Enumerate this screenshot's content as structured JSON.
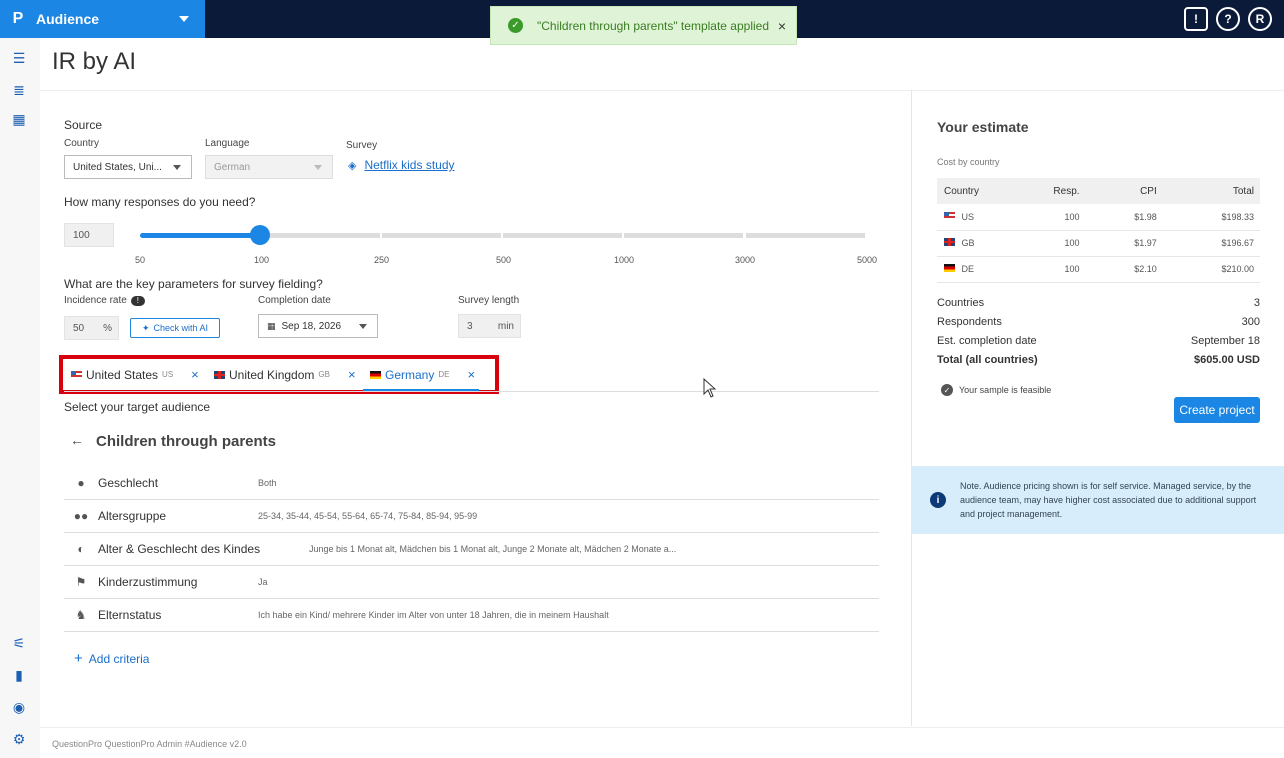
{
  "topbar": {
    "logo": "P",
    "app_name": "Audience",
    "icons": [
      "feedback-icon",
      "help-icon",
      "user-avatar"
    ],
    "help_label": "?",
    "avatar_label": "R",
    "feedback_label": "!"
  },
  "toast": {
    "message": "\"Children through parents\" template applied",
    "close": "×"
  },
  "page": {
    "title": "IR by AI"
  },
  "source": {
    "heading": "Source",
    "country_label": "Country",
    "country_value": "United States, Uni...",
    "language_label": "Language",
    "language_value": "German",
    "survey_label": "Survey",
    "survey_link": "Netflix kids study"
  },
  "responses": {
    "question": "How many responses do you need?",
    "value": "100",
    "ticks": [
      "50",
      "100",
      "250",
      "500",
      "1000",
      "3000",
      "5000"
    ]
  },
  "params": {
    "question": "What are the key parameters for survey fielding?",
    "incidence_label": "Incidence rate",
    "incidence_value": "50",
    "incidence_unit": "%",
    "check_ai": "Check with AI",
    "completion_label": "Completion date",
    "completion_value": "Sep 18, 2026",
    "length_label": "Survey length",
    "length_value": "3",
    "length_unit": "min"
  },
  "tabs": [
    {
      "label": "United States",
      "code": "US"
    },
    {
      "label": "United Kingdom",
      "code": "GB"
    },
    {
      "label": "Germany",
      "code": "DE"
    }
  ],
  "tab_close": "×",
  "audience": {
    "select_label": "Select your target audience",
    "template_title": "Children through parents",
    "criteria": [
      {
        "name": "Geschlecht",
        "value": "Both",
        "icon": "person-icon"
      },
      {
        "name": "Altersgruppe",
        "value": "25-34, 35-44, 45-54, 55-64, 65-74, 75-84, 85-94, 95-99",
        "icon": "people-icon"
      },
      {
        "name": "Alter & Geschlecht des Kindes",
        "value": "Junge bis 1 Monat alt, Mädchen bis 1 Monat alt, Junge 2 Monate alt, Mädchen 2 Monate a...",
        "icon": "child-icon"
      },
      {
        "name": "Kinderzustimmung",
        "value": "Ja",
        "icon": "flag-icon"
      },
      {
        "name": "Elternstatus",
        "value": "Ich habe ein Kind/ mehrere Kinder im Alter von unter 18 Jahren, die in meinem Haushalt",
        "icon": "family-icon"
      }
    ],
    "add_criteria": "Add criteria"
  },
  "estimate": {
    "title": "Your estimate",
    "cost_label": "Cost by country",
    "columns": [
      "Country",
      "Resp.",
      "CPI",
      "Total"
    ],
    "rows": [
      {
        "country": "US",
        "resp": "100",
        "cpi": "$1.98",
        "total": "$198.33"
      },
      {
        "country": "GB",
        "resp": "100",
        "cpi": "$1.97",
        "total": "$196.67"
      },
      {
        "country": "DE",
        "resp": "100",
        "cpi": "$2.10",
        "total": "$210.00"
      }
    ],
    "summary": [
      {
        "label": "Countries",
        "value": "3"
      },
      {
        "label": "Respondents",
        "value": "300"
      },
      {
        "label": "Est. completion date",
        "value": "September 18"
      },
      {
        "label": "Total (all countries)",
        "value": "$605.00 USD"
      }
    ],
    "feasible": "Your sample is feasible",
    "create_button": "Create project",
    "note": "Note. Audience pricing shown is for self service. Managed service, by the audience team, may have higher cost associated due to additional support and project management."
  },
  "footer": {
    "text": "QuestionPro QuestionPro Admin  #Audience v2.0"
  },
  "colors": {
    "accent": "#1b86e3",
    "topbar": "#0c1a3a",
    "highlight": "#d9000d",
    "toast_bg": "#dff3d6"
  }
}
